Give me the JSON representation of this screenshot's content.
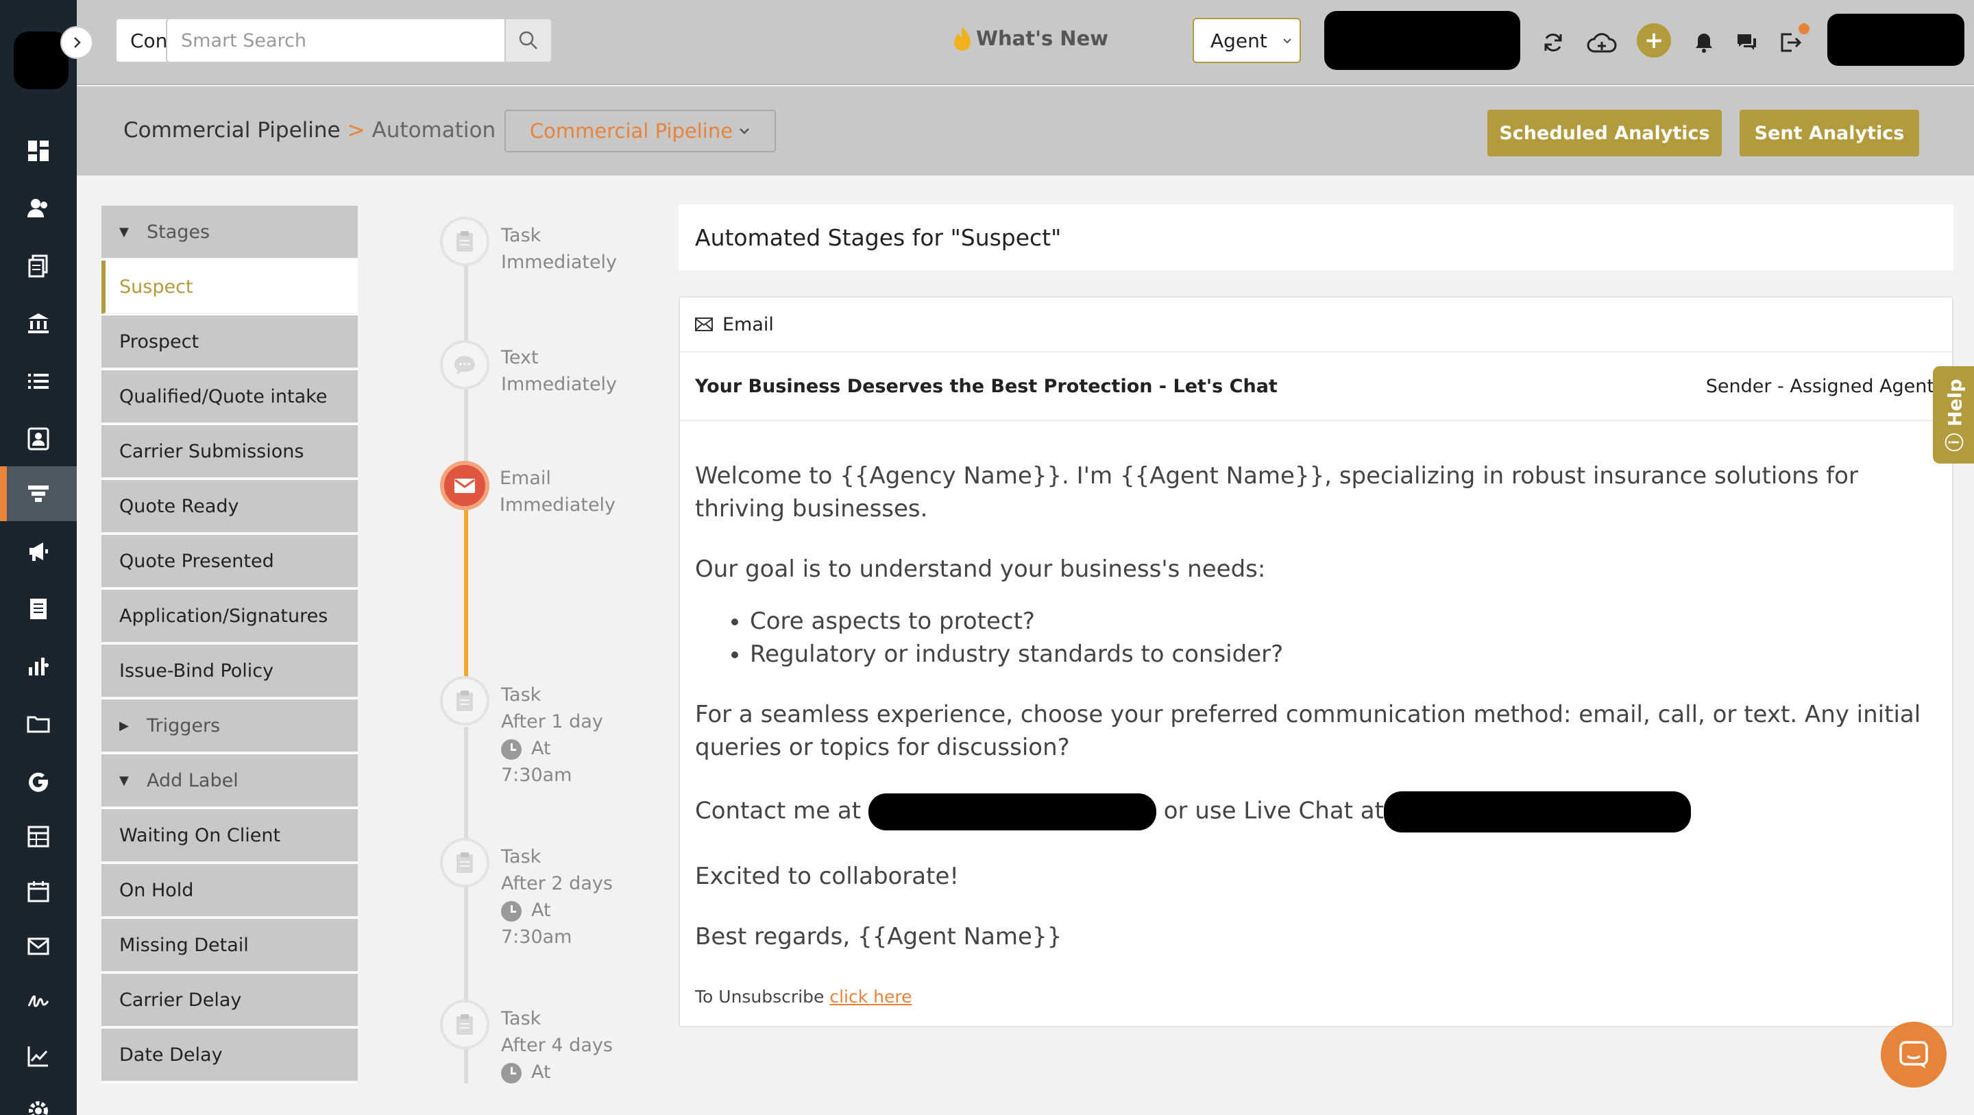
{
  "topbar": {
    "contact_select": "Contact",
    "search_placeholder": "Smart Search",
    "whats_new": "What's New",
    "agent_select": "Agent"
  },
  "subheader": {
    "breadcrumb_root": "Commercial Pipeline",
    "breadcrumb_sep": ">",
    "breadcrumb_current": "Automation",
    "pipeline_select": "Commercial Pipeline",
    "scheduled_analytics": "Scheduled Analytics",
    "sent_analytics": "Sent Analytics"
  },
  "stages": {
    "groups": {
      "stages": "Stages",
      "triggers": "Triggers",
      "add_label": "Add Label"
    },
    "items": [
      "Suspect",
      "Prospect",
      "Qualified/Quote intake",
      "Carrier Submissions",
      "Quote Ready",
      "Quote Presented",
      "Application/Signatures",
      "Issue-Bind Policy"
    ],
    "labels": [
      "Waiting On Client",
      "On Hold",
      "Missing Detail",
      "Carrier Delay",
      "Date Delay"
    ]
  },
  "timeline": [
    {
      "type": "Task",
      "timing": "Immediately"
    },
    {
      "type": "Text",
      "timing": "Immediately"
    },
    {
      "type": "Email",
      "timing": "Immediately"
    },
    {
      "type": "Task",
      "timing": "After 1 day",
      "at": "At",
      "time": "7:30am"
    },
    {
      "type": "Task",
      "timing": "After 2 days",
      "at": "At",
      "time": "7:30am"
    },
    {
      "type": "Task",
      "timing": "After 4 days",
      "at": "At"
    }
  ],
  "main": {
    "title": "Automated Stages for \"Suspect\"",
    "email": {
      "header": "Email",
      "subject": "Your Business Deserves the Best Protection - Let's Chat",
      "sender": "Sender - Assigned Agent",
      "p1": "Welcome to {{Agency Name}}. I'm {{Agent Name}}, specializing in robust insurance solutions for thriving businesses.",
      "p2": "Our goal is to understand your business's needs:",
      "bullets": [
        "Core aspects to protect?",
        "Regulatory or industry standards to consider?"
      ],
      "p3": "For a seamless experience, choose your preferred communication method: email, call, or text. Any initial queries or topics for discussion?",
      "contact_prefix": "Contact me at",
      "contact_mid": "or use Live Chat at",
      "p5": "Excited to collaborate!",
      "p6": "Best regards, {{Agent Name}}",
      "unsub_prefix": "To Unsubscribe",
      "unsub_link": "click here"
    }
  },
  "help": "Help"
}
